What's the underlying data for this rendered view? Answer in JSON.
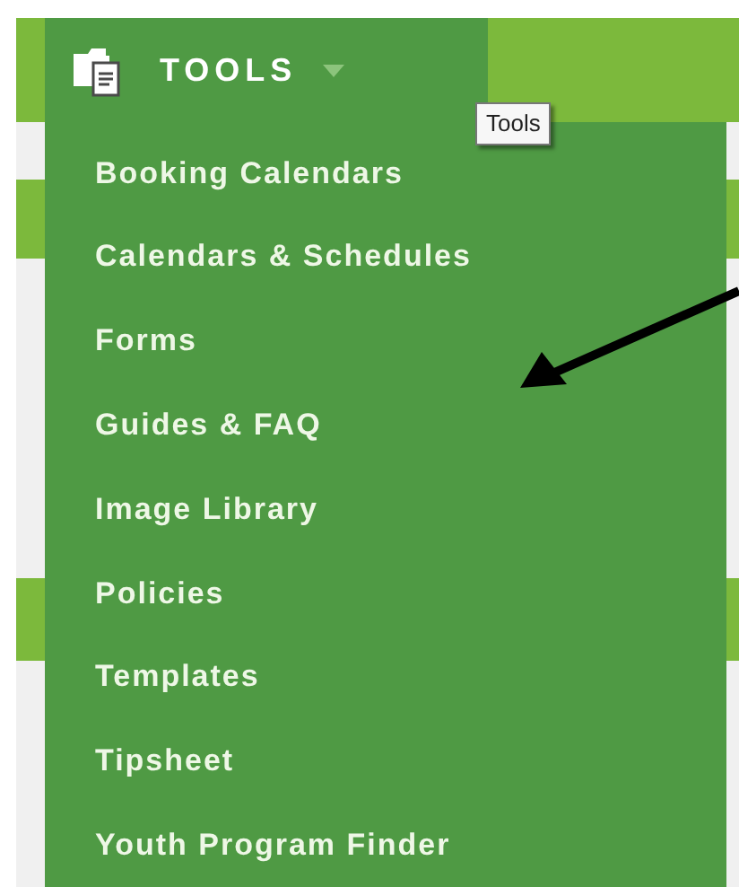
{
  "menu": {
    "label": "TOOLS",
    "expanded": true
  },
  "tooltip": "Tools",
  "items": [
    {
      "label": "Booking Calendars"
    },
    {
      "label": "Calendars & Schedules"
    },
    {
      "label": "Forms"
    },
    {
      "label": "Guides & FAQ"
    },
    {
      "label": "Image Library"
    },
    {
      "label": "Policies"
    },
    {
      "label": "Templates"
    },
    {
      "label": "Tipsheet"
    },
    {
      "label": "Youth Program Finder"
    }
  ]
}
